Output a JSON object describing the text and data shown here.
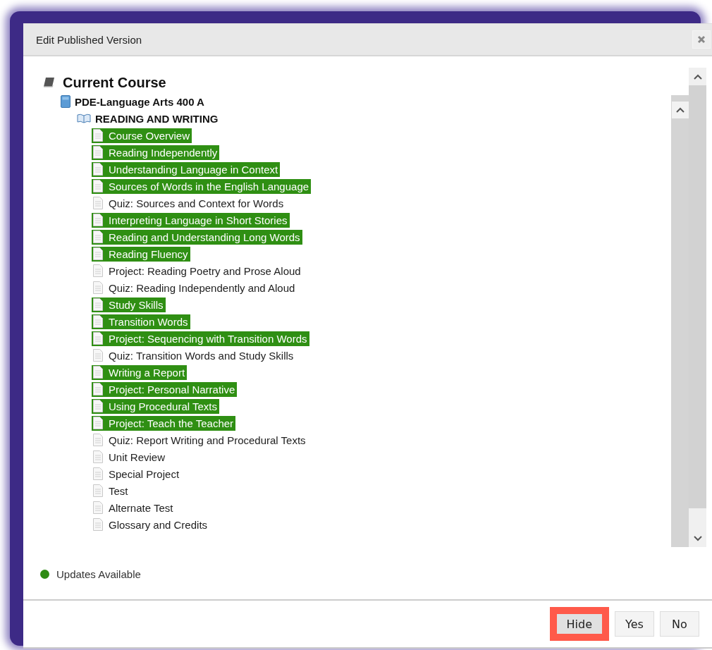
{
  "dialog": {
    "title": "Edit Published Version"
  },
  "tree": {
    "root": "Current Course",
    "course": "PDE-Language Arts 400 A",
    "unit": "READING AND WRITING",
    "items": [
      {
        "label": "Course Overview",
        "updated": true
      },
      {
        "label": "Reading Independently",
        "updated": true
      },
      {
        "label": "Understanding Language in Context",
        "updated": true
      },
      {
        "label": "Sources of Words in the English Language",
        "updated": true
      },
      {
        "label": "Quiz: Sources and Context for Words",
        "updated": false
      },
      {
        "label": "Interpreting Language in Short Stories",
        "updated": true
      },
      {
        "label": "Reading and Understanding Long Words",
        "updated": true
      },
      {
        "label": "Reading Fluency",
        "updated": true
      },
      {
        "label": "Project: Reading Poetry and Prose Aloud",
        "updated": false
      },
      {
        "label": "Quiz: Reading Independently and Aloud",
        "updated": false
      },
      {
        "label": "Study Skills",
        "updated": true
      },
      {
        "label": "Transition Words",
        "updated": true
      },
      {
        "label": "Project: Sequencing with Transition Words",
        "updated": true
      },
      {
        "label": "Quiz: Transition Words and Study Skills",
        "updated": false
      },
      {
        "label": "Writing a Report",
        "updated": true
      },
      {
        "label": "Project: Personal Narrative",
        "updated": true
      },
      {
        "label": "Using Procedural Texts",
        "updated": true
      },
      {
        "label": "Project: Teach the Teacher",
        "updated": true
      },
      {
        "label": "Quiz: Report Writing and Procedural Texts",
        "updated": false
      },
      {
        "label": "Unit Review",
        "updated": false
      },
      {
        "label": "Special Project",
        "updated": false
      },
      {
        "label": "Test",
        "updated": false
      },
      {
        "label": "Alternate Test",
        "updated": false
      },
      {
        "label": "Glossary and Credits",
        "updated": false
      }
    ]
  },
  "legend": {
    "label": "Updates Available",
    "color": "#2e8b14"
  },
  "buttons": [
    {
      "label": "Hide",
      "highlighted": true
    },
    {
      "label": "Yes",
      "highlighted": false
    },
    {
      "label": "No",
      "highlighted": false
    }
  ]
}
